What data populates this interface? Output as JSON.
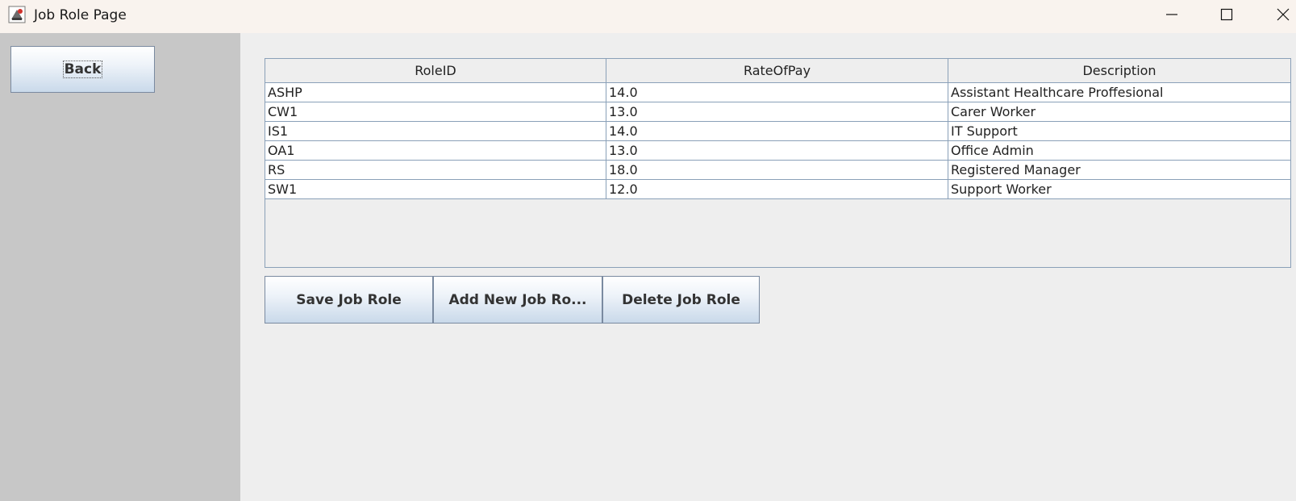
{
  "window": {
    "title": "Job Role Page",
    "minimize_icon": "minimize-icon",
    "maximize_icon": "maximize-icon",
    "close_icon": "close-icon"
  },
  "sidebar": {
    "back_label": "Back"
  },
  "table": {
    "columns": [
      "RoleID",
      "RateOfPay",
      "Description"
    ],
    "rows": [
      [
        "ASHP",
        "14.0",
        "Assistant Healthcare Proffesional"
      ],
      [
        "CW1",
        "13.0",
        "Carer Worker"
      ],
      [
        "IS1",
        "14.0",
        "IT Support"
      ],
      [
        "OA1",
        "13.0",
        "Office Admin"
      ],
      [
        "RS",
        "18.0",
        "Registered Manager"
      ],
      [
        "SW1",
        "12.0",
        "Support Worker"
      ]
    ]
  },
  "actions": {
    "save_label": "Save Job Role",
    "add_label": "Add New Job Ro...",
    "delete_label": "Delete Job Role"
  },
  "colors": {
    "titlebar_bg": "#f9f3ee",
    "sidebar_bg": "#c7c7c7",
    "content_bg": "#eeeeee",
    "grid_line": "#8aa0b8"
  }
}
